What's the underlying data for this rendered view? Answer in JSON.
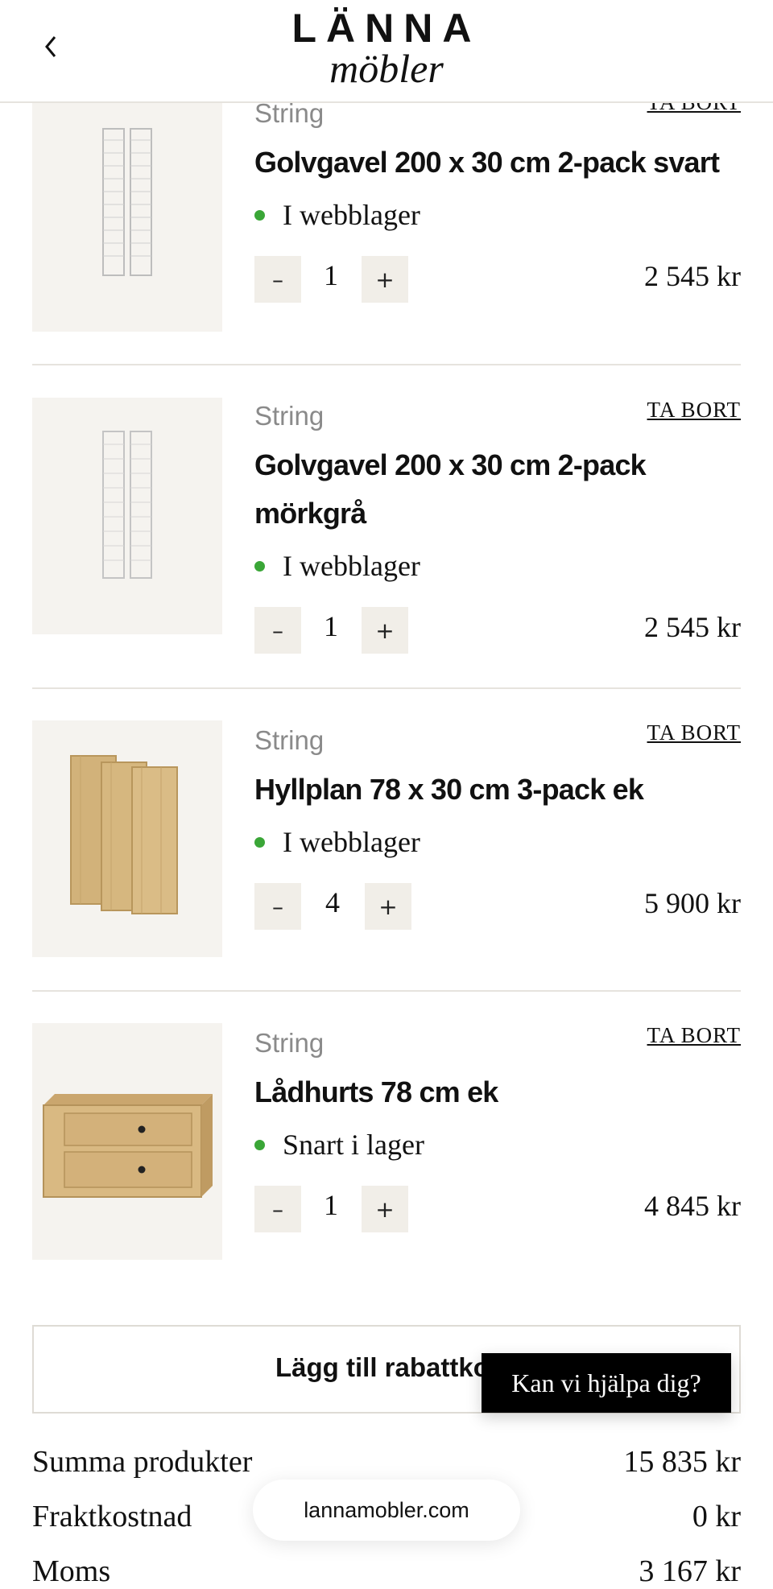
{
  "header": {
    "brand_top": "LÄNNA",
    "brand_bottom": "möbler",
    "back_icon": "chevron-left-icon"
  },
  "cart": {
    "remove_label": "TA BORT",
    "items": [
      {
        "brand": "String",
        "name": "Golvgavel 200 x 30 cm 2-pack svart",
        "stock": "I webblager",
        "stock_color": "#3aa637",
        "quantity": "1",
        "price": "2 545 kr",
        "image_icon": "wire-shelf-panel-black"
      },
      {
        "brand": "String",
        "name": "Golvgavel 200 x 30 cm 2-pack mörkgrå",
        "stock": "I webblager",
        "stock_color": "#3aa637",
        "quantity": "1",
        "price": "2 545 kr",
        "image_icon": "wire-shelf-panel-grey"
      },
      {
        "brand": "String",
        "name": "Hyllplan 78 x 30 cm 3-pack ek",
        "stock": "I webblager",
        "stock_color": "#3aa637",
        "quantity": "4",
        "price": "5 900 kr",
        "image_icon": "oak-shelves"
      },
      {
        "brand": "String",
        "name": "Lådhurts 78 cm ek",
        "stock": "Snart i lager",
        "stock_color": "#3aa637",
        "quantity": "1",
        "price": "4 845 kr",
        "image_icon": "oak-drawer-chest"
      }
    ],
    "minus_symbol": "–",
    "plus_symbol": "+"
  },
  "discount": {
    "label": "Lägg till rabattkod"
  },
  "help": {
    "label": "Kan vi hjälpa dig?"
  },
  "summary": {
    "products_label": "Summa produkter",
    "products_value": "15 835 kr",
    "shipping_label": "Fraktkostnad",
    "shipping_value": "0 kr",
    "vat_label": "Moms",
    "vat_value": "3 167 kr"
  },
  "browser": {
    "url": "lannamobler.com"
  }
}
